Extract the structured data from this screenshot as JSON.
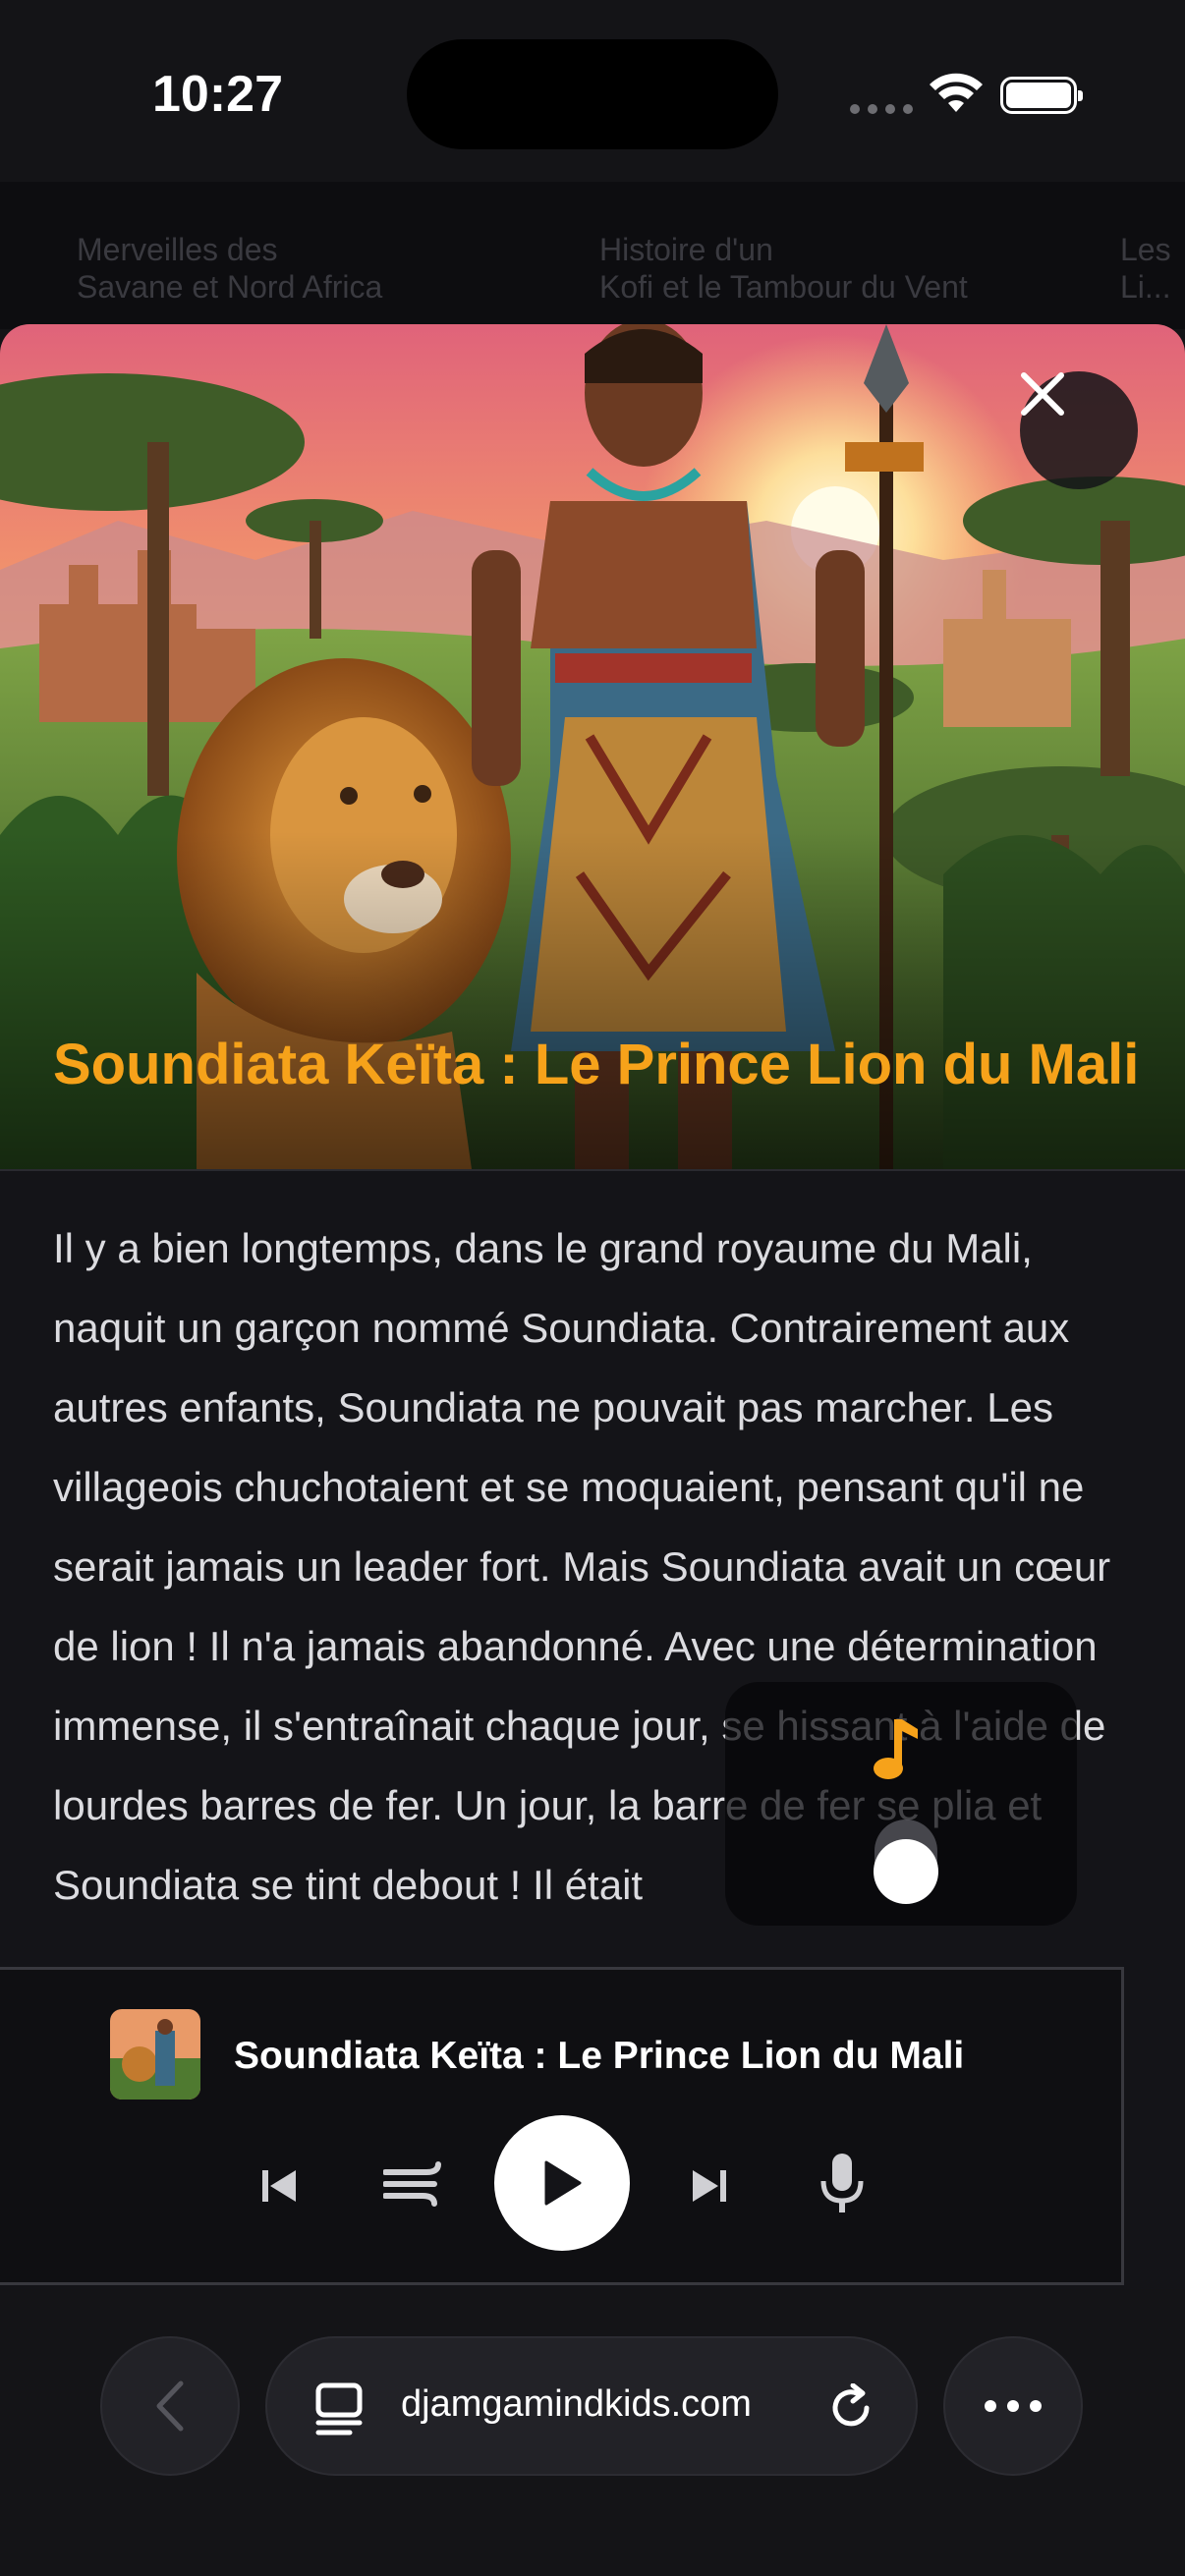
{
  "status_bar": {
    "time": "10:27"
  },
  "background_page": {
    "cards": [
      {
        "line1": "Merveilles des",
        "line2": "Savane et Nord Africa"
      },
      {
        "line1": "Histoire d'un",
        "line2": "Kofi et le Tambour du Vent"
      },
      {
        "line1": "Les",
        "line2": "Li..."
      }
    ]
  },
  "story": {
    "title": "Soundiata Keïta : Le Prince Lion du Mali",
    "paragraphs": [
      " Il y a bien longtemps, dans le grand royaume du Mali, naquit un garçon nommé Soundiata.  Contrairement aux autres enfants, Soundiata ne pouvait pas marcher.  Les villageois chuchotaient et se moquaient, pensant qu'il ne serait jamais un leader fort.  Mais Soundiata avait un cœur de lion !  Il n'a jamais abandonné.  Avec une détermination immense, il s'entraînait chaque jour, se hissant à l'aide de lourdes barres de fer.  Un jour, la barre de fer se plia et Soundiata se tint debout ! Il était"
    ]
  },
  "player": {
    "title": "Soundiata Keïta : Le Prince Lion du Mali",
    "icons": [
      "skip-back-icon",
      "wind-icon",
      "play-icon",
      "skip-forward-icon",
      "microphone-icon"
    ]
  },
  "browser": {
    "url": "djamgamindkids.com"
  },
  "colors": {
    "accent": "#f6a21a",
    "background": "#141417"
  }
}
